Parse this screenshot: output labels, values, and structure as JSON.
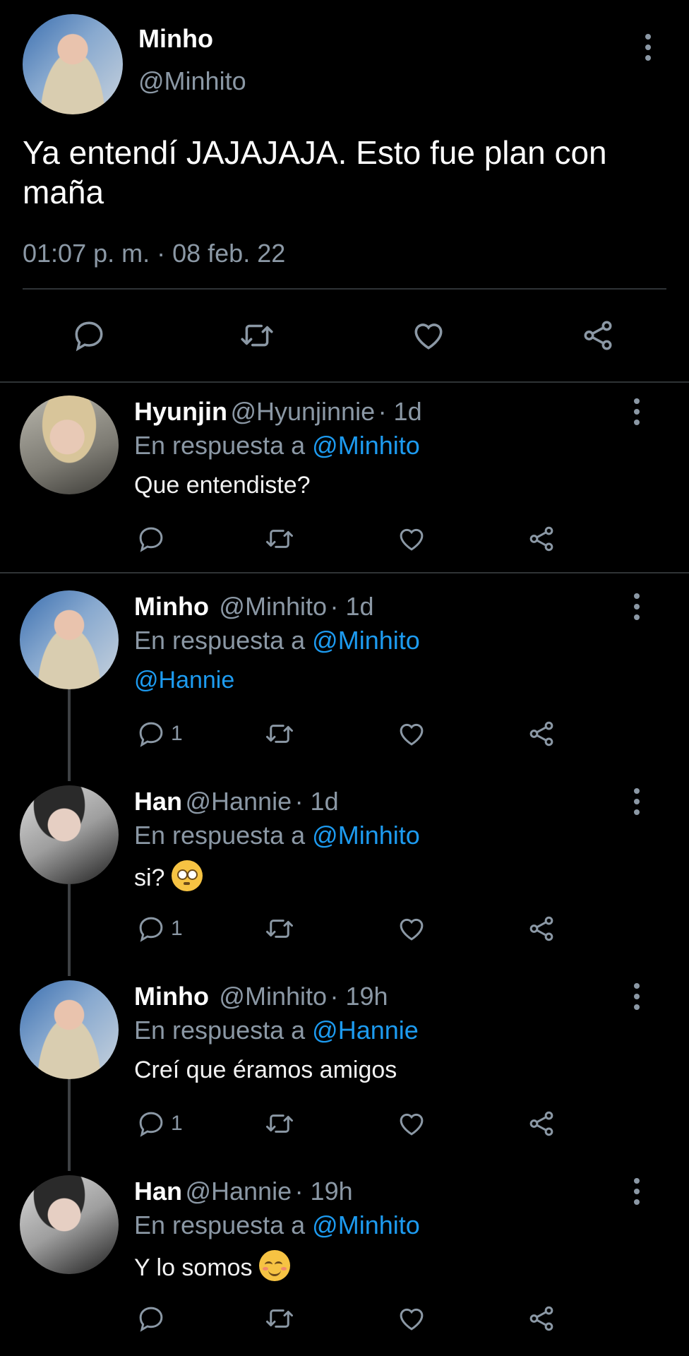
{
  "main_tweet": {
    "name": "Minho",
    "handle": "@Minhito",
    "text": "Ya entendí JAJAJAJA. Esto fue plan con maña",
    "timestamp": "01:07 p. m. · 08 feb. 22",
    "avatar": "minho-avatar"
  },
  "replies": [
    {
      "name": "Hyunjin",
      "handle": "@Hyunjinnie",
      "time": "· 1d",
      "reply_prefix": "En respuesta a ",
      "reply_to": "@Minhito",
      "text": "Que entendiste?",
      "reply_count": ""
    },
    {
      "name": "Minho",
      "handle": "@Minhito",
      "time": "· 1d",
      "reply_prefix": "En respuesta a ",
      "reply_to": "@Minhito",
      "text": "@Hannie",
      "reply_count": "1"
    },
    {
      "name": "Han",
      "handle": "@Hannie",
      "time": "· 1d",
      "reply_prefix": "En respuesta a ",
      "reply_to": "@Minhito",
      "text": "si?",
      "emoji": "pleading-face",
      "reply_count": "1"
    },
    {
      "name": "Minho",
      "handle": "@Minhito",
      "time": "· 19h",
      "reply_prefix": "En respuesta a ",
      "reply_to": "@Hannie",
      "text": "Creí que éramos amigos",
      "reply_count": "1"
    },
    {
      "name": "Han",
      "handle": "@Hannie",
      "time": "· 19h",
      "reply_prefix": "En respuesta a ",
      "reply_to": "@Minhito",
      "text": "Y lo somos",
      "emoji": "smiling-face",
      "reply_count": ""
    }
  ],
  "colors": {
    "background": "#000000",
    "secondary_text": "#8b98a5",
    "link": "#1d9bf0",
    "divider": "#2f3336"
  }
}
